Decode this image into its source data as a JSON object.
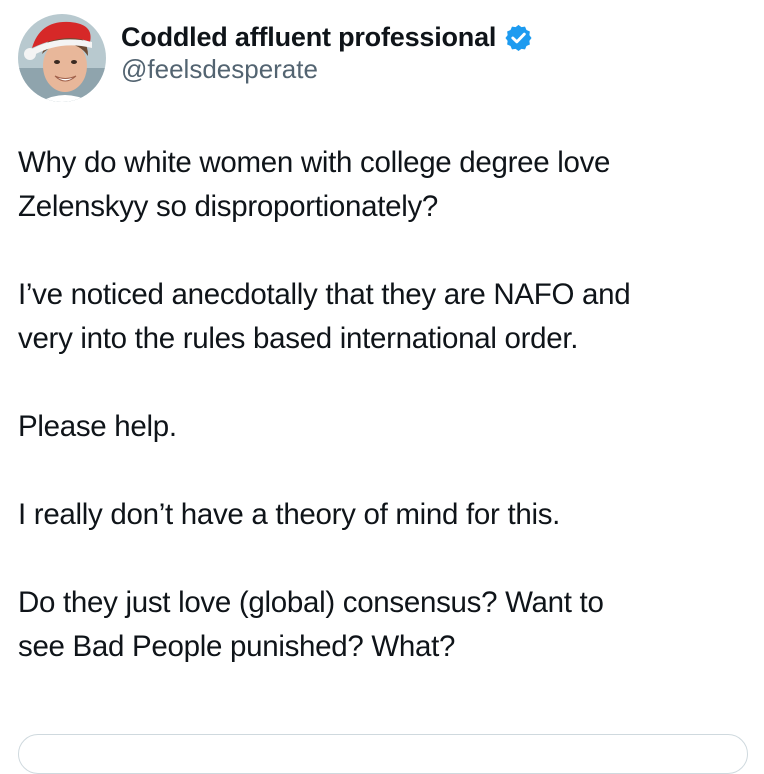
{
  "author": {
    "display_name": "Coddled affluent professional",
    "handle": "@feelsdesperate",
    "verified": true,
    "verified_icon": "verified-badge-icon",
    "verified_color": "#1d9bf0"
  },
  "tweet": {
    "paragraphs": [
      {
        "lines": [
          "Why do white women with college degree love",
          "Zelenskyy so disproportionately?"
        ]
      },
      {
        "lines": [
          "I’ve noticed anecdotally that they are NAFO and",
          "very into the rules based international order."
        ]
      },
      {
        "lines": [
          "Please help."
        ]
      },
      {
        "lines": [
          "I really don’t have a theory of mind for this."
        ]
      },
      {
        "lines": [
          "Do they just love (global) consensus? Want to",
          "see Bad People punished? What?"
        ]
      }
    ]
  },
  "colors": {
    "text": "#0f1419",
    "secondary_text": "#536471",
    "border": "#cfd9de"
  }
}
